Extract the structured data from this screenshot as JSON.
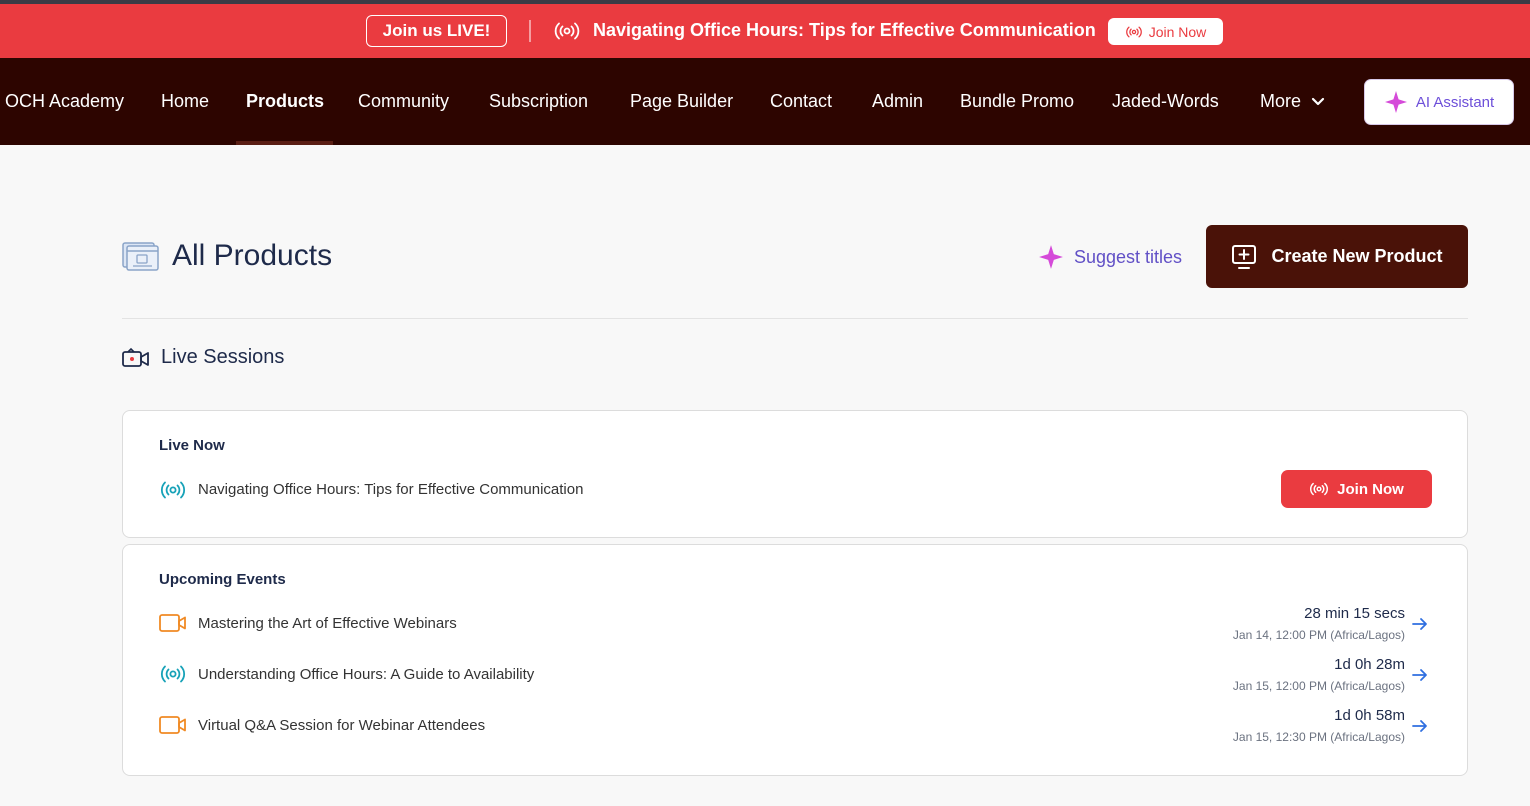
{
  "banner": {
    "join_live_label": "Join us LIVE!",
    "title": "Navigating Office Hours: Tips for Effective Communication",
    "join_now_label": "Join Now"
  },
  "nav": {
    "brand": "OCH Academy",
    "items": [
      "Home",
      "Products",
      "Community",
      "Subscription",
      "Page Builder",
      "Contact",
      "Admin",
      "Bundle Promo",
      "Jaded-Words",
      "More"
    ],
    "active": "Products",
    "ai_assistant_label": "AI Assistant"
  },
  "page": {
    "title": "All Products",
    "suggest_titles_label": "Suggest titles",
    "create_button_label": "Create New Product"
  },
  "live_sessions": {
    "section_title": "Live Sessions",
    "live_now": {
      "heading": "Live Now",
      "session_title": "Navigating Office Hours: Tips for Effective Communication",
      "join_label": "Join Now"
    },
    "upcoming": {
      "heading": "Upcoming Events",
      "events": [
        {
          "title": "Mastering the Art of Effective Webinars",
          "icon": "video-icon",
          "countdown": "28 min 15 secs",
          "datetime": "Jan 14, 12:00 PM (Africa/Lagos)"
        },
        {
          "title": "Understanding Office Hours: A Guide to Availability",
          "icon": "broadcast-icon",
          "countdown": "1d 0h 28m",
          "datetime": "Jan 15, 12:00 PM (Africa/Lagos)"
        },
        {
          "title": "Virtual Q&A Session for Webinar Attendees",
          "icon": "video-icon",
          "countdown": "1d 0h 58m",
          "datetime": "Jan 15, 12:30 PM (Africa/Lagos)"
        }
      ]
    }
  },
  "colors": {
    "banner_bg": "#ea3b40",
    "nav_bg": "#2d0500",
    "create_button_bg": "#4a1208",
    "ai_accent": "#6d4fd9",
    "broadcast_teal": "#17a2b8",
    "video_orange": "#f08a24"
  }
}
